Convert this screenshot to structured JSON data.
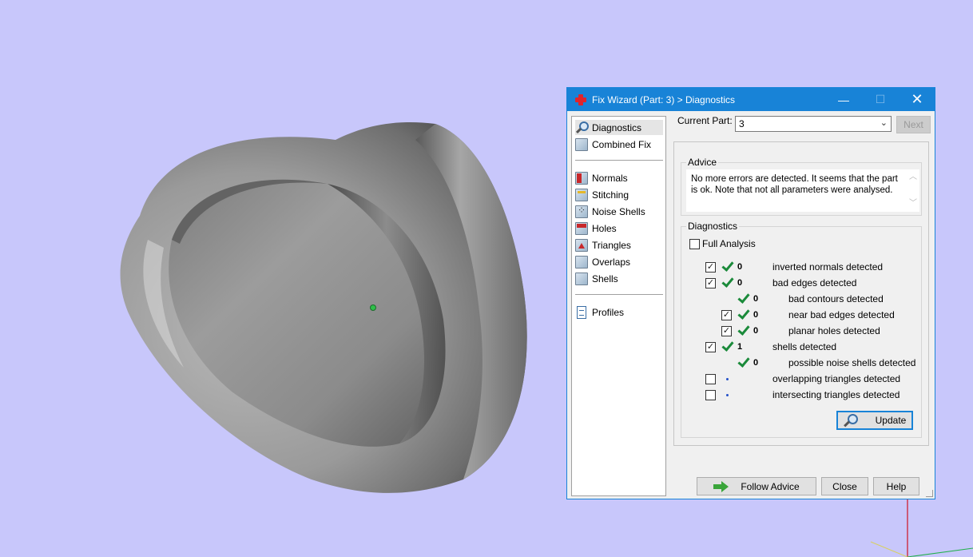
{
  "window": {
    "title": "Fix Wizard (Part: 3) > Diagnostics",
    "minimize_glyph": "—",
    "maximize_glyph": "☐",
    "close_glyph": "✕"
  },
  "nav": {
    "items": [
      {
        "label": "Diagnostics",
        "icon": "magnifier-icon",
        "selected": true
      },
      {
        "label": "Combined Fix",
        "icon": "cube-icon"
      },
      {
        "label": "Normals",
        "icon": "cube-red-icon"
      },
      {
        "label": "Stitching",
        "icon": "cube-yellow-icon"
      },
      {
        "label": "Noise Shells",
        "icon": "dice-icon"
      },
      {
        "label": "Holes",
        "icon": "cube-red-top-icon"
      },
      {
        "label": "Triangles",
        "icon": "cube-triangle-icon"
      },
      {
        "label": "Overlaps",
        "icon": "cube-icon"
      },
      {
        "label": "Shells",
        "icon": "cube-icon"
      },
      {
        "label": "Profiles",
        "icon": "document-icon"
      }
    ]
  },
  "current_part": {
    "label": "Current Part:",
    "value": "3",
    "dropdown_glyph": "⌄",
    "next_label": "Next"
  },
  "advice": {
    "title": "Advice",
    "text": "No more errors are detected. It seems that the part is ok. Note that not all parameters were analysed.",
    "scroll_up": "︿",
    "scroll_down": "﹀"
  },
  "diagnostics": {
    "title": "Diagnostics",
    "full_analysis_label": "Full Analysis",
    "full_analysis_checked": false,
    "rows": [
      {
        "checkbox": true,
        "checked": true,
        "status": "ok",
        "count": "0",
        "label": "inverted normals detected",
        "indent": 0
      },
      {
        "checkbox": true,
        "checked": true,
        "status": "ok",
        "count": "0",
        "label": "bad edges detected",
        "indent": 0
      },
      {
        "checkbox": false,
        "checked": false,
        "status": "ok",
        "count": "0",
        "label": "bad contours detected",
        "indent": 1
      },
      {
        "checkbox": true,
        "checked": true,
        "status": "ok",
        "count": "0",
        "label": "near bad edges detected",
        "indent": 1
      },
      {
        "checkbox": true,
        "checked": true,
        "status": "ok",
        "count": "0",
        "label": "planar holes detected",
        "indent": 1
      },
      {
        "checkbox": true,
        "checked": true,
        "status": "ok",
        "count": "1",
        "label": "shells detected",
        "indent": 0
      },
      {
        "checkbox": false,
        "checked": false,
        "status": "ok",
        "count": "0",
        "label": "possible noise shells detected",
        "indent": 1
      },
      {
        "checkbox": true,
        "checked": false,
        "status": "pending",
        "count": "",
        "label": "overlapping triangles detected",
        "indent": 0
      },
      {
        "checkbox": true,
        "checked": false,
        "status": "pending",
        "count": "",
        "label": "intersecting triangles detected",
        "indent": 0
      }
    ],
    "update_label": "Update"
  },
  "footer": {
    "follow_label": "Follow Advice",
    "close_label": "Close",
    "help_label": "Help"
  },
  "colors": {
    "viewport_bg": "#c8c7fb",
    "title_bar": "#1883d7",
    "ok_check": "#1a8a3a"
  }
}
